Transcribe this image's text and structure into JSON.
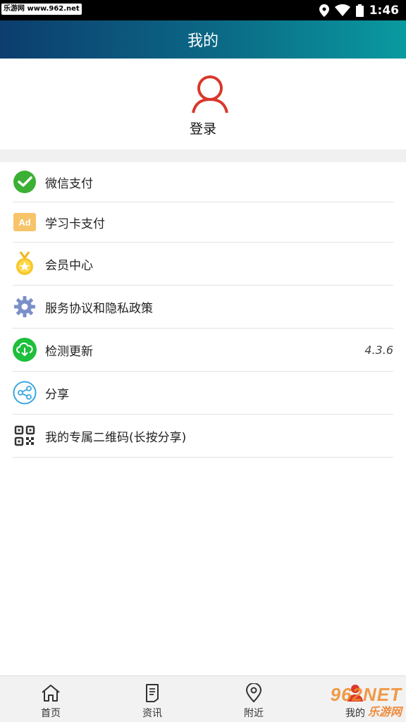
{
  "status_bar": {
    "watermark": "乐游网 www.962.net",
    "time": "1:46",
    "icons": [
      "location-icon",
      "wifi-icon",
      "battery-icon"
    ]
  },
  "header": {
    "title": "我的"
  },
  "profile": {
    "login_label": "登录",
    "avatar_icon": "user-outline-icon"
  },
  "menu": {
    "items": [
      {
        "label": "微信支付",
        "icon": "wechat-pay-icon"
      },
      {
        "label": "学习卡支付",
        "icon": "ad-card-icon"
      },
      {
        "label": "会员中心",
        "icon": "medal-icon"
      },
      {
        "label": "服务协议和隐私政策",
        "icon": "gear-icon"
      },
      {
        "label": "检测更新",
        "icon": "cloud-download-icon",
        "value": "4.3.6"
      },
      {
        "label": "分享",
        "icon": "share-icon"
      },
      {
        "label": "我的专属二维码(长按分享)",
        "icon": "qr-code-icon"
      }
    ]
  },
  "bottom_nav": {
    "items": [
      {
        "label": "首页",
        "icon": "home-icon"
      },
      {
        "label": "资讯",
        "icon": "news-icon"
      },
      {
        "label": "附近",
        "icon": "location-pin-icon"
      },
      {
        "label": "我的",
        "icon": "profile-icon"
      }
    ]
  },
  "watermark_bottom": {
    "main": "962NET",
    "sub": "乐游网"
  },
  "colors": {
    "header_gradient": [
      "#0c3d6e",
      "#0a9aa0"
    ],
    "avatar_red": "#d9382c",
    "wechat_green": "#3cb034",
    "update_green": "#1dbf3b"
  }
}
